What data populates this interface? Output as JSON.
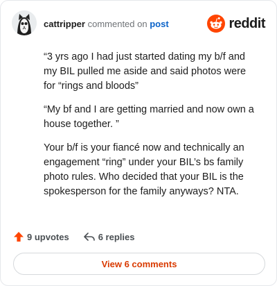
{
  "comment": {
    "username": "cattripper",
    "action_text": "commented on",
    "post_link_label": "post",
    "paragraphs": [
      "“3 yrs ago I had just started dating my b/f and my BIL pulled me aside and said photos were for “rings and bloods”",
      "“My bf and I are getting married and now own a house together. ”",
      "Your b/f is your fiancé now and technically an engagement “ring” under your BIL’s bs family photo rules. Who decided that your BIL is the spokesperson for the family anyways? NTA."
    ]
  },
  "brand": {
    "wordmark": "reddit",
    "icon": "reddit-snoo-icon",
    "color": "#ff4500"
  },
  "actions": {
    "upvotes_label": "9 upvotes",
    "upvote_icon": "upvote-arrow-icon",
    "upvote_color": "#ff4500",
    "replies_label": "6 replies",
    "reply_icon": "reply-arrow-icon"
  },
  "view_comments_label": "View 6 comments"
}
